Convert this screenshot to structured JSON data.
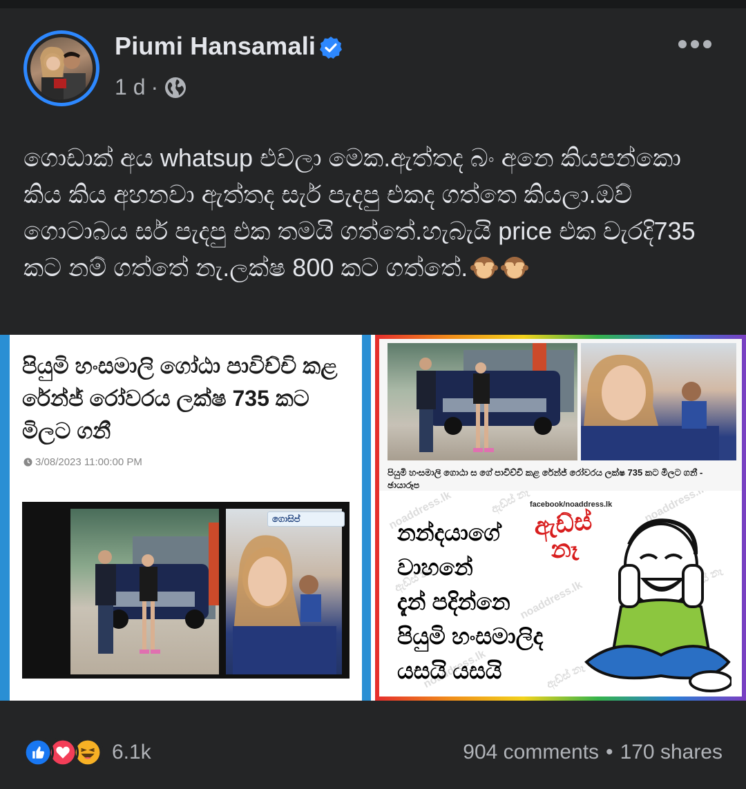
{
  "post": {
    "author": "Piumi Hansamali",
    "time": "1 d",
    "separator": "·",
    "caption": "ගොඩාක් අය whatsup එවලා මෙක.ඇත්තද බං අනෙ කියපන්කො කිය කිය අහනවා ඇත්තද සැර් පැදපු එකද ගත්තෙ කියලා.ඔව් ගොටාබය සර් පැදපු එක තමයි ගත්තේ.හැබැයි price එක වැරදි735 කට නම් ගත්තේ නැ.ලක්ෂ 800 කට ගත්තේ.",
    "icons": {
      "verified": "verified-badge-icon",
      "audience": "globe-icon",
      "menu": "more-dots-icon",
      "emoji": "see-no-evil-monkey-icon"
    },
    "colors": {
      "accent": "#2d88ff",
      "background": "#242526"
    }
  },
  "media": {
    "left": {
      "headline": "පියුමි හංසමාලි ගෝඨා පාවිච්චි කළ රේන්ජ් රෝවරය ලක්ෂ 735 කට මිලට ගනී",
      "date": "3/08/2023 11:00:00 PM",
      "logo": "ගොසිප්"
    },
    "right": {
      "caption": "පියුමි හංසමාලි ගොඨා ස ගේ පාවිච්චි කළ රේන්ජ් රෝවරය ලක්ෂ 735 කට මිලට ගනී - ඡායාරූප",
      "fb_tag": "facebook/noaddress.lk",
      "badge": "ඇඩ්ස් නෑ",
      "meme_lines": [
        "නන්දයාගේ",
        "වාහනේ",
        "දැන් පදින්නෙ",
        "පියුමි හංසමාලිද",
        "යසයි යසයි"
      ]
    }
  },
  "footer": {
    "reaction_count": "6.1k",
    "comments": "904 comments",
    "dot": "•",
    "shares": "170 shares",
    "reaction_icons": [
      "like-icon",
      "love-icon",
      "haha-icon"
    ]
  }
}
